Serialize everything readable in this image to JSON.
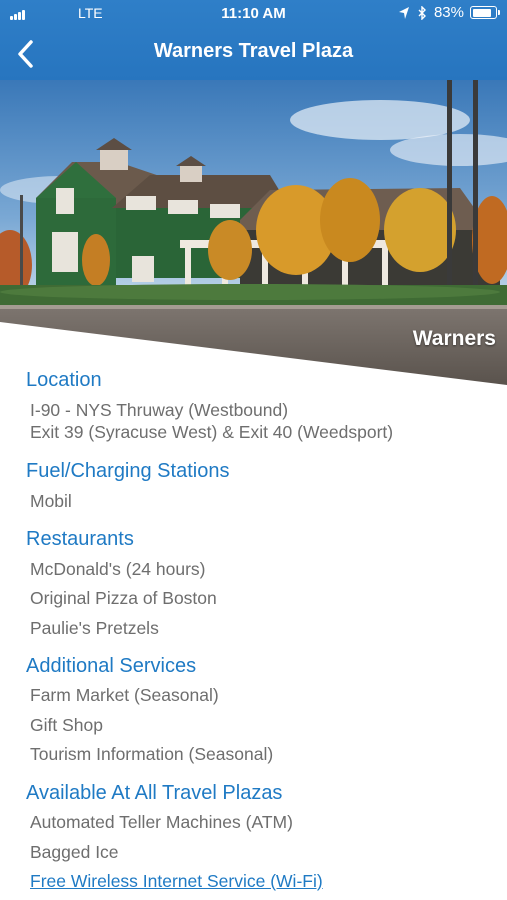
{
  "status_bar": {
    "carrier": "LTE",
    "time": "11:10 AM",
    "battery": "83%",
    "battery_level": 0.83,
    "icons": [
      "signal-bars-icon",
      "location-arrow-icon",
      "bluetooth-icon",
      "battery-icon"
    ]
  },
  "nav": {
    "back_icon": "chevron-left-icon",
    "title": "Warners Travel Plaza"
  },
  "hero": {
    "caption": "Warners"
  },
  "sections": {
    "location": {
      "title": "Location",
      "lines": [
        "I-90 - NYS Thruway (Westbound)",
        "Exit 39 (Syracuse West) & Exit 40 (Weedsport)"
      ]
    },
    "fuel": {
      "title": "Fuel/Charging Stations",
      "lines": [
        "Mobil"
      ]
    },
    "restaurants": {
      "title": "Restaurants",
      "lines": [
        "McDonald's (24 hours)",
        "Original Pizza of Boston",
        "Paulie's Pretzels"
      ]
    },
    "services": {
      "title": "Additional Services",
      "lines": [
        "Farm Market (Seasonal)",
        "Gift Shop",
        "Tourism Information (Seasonal)"
      ]
    },
    "all_plazas": {
      "title": "Available At All Travel Plazas",
      "lines": [
        "Automated Teller Machines (ATM)",
        "Bagged Ice"
      ],
      "link": "Free Wireless Internet Service (Wi-Fi)"
    }
  },
  "colors": {
    "header_blue": "#2a79c3",
    "section_blue": "#1f7ac4",
    "body_gray": "#6e6e6e"
  }
}
